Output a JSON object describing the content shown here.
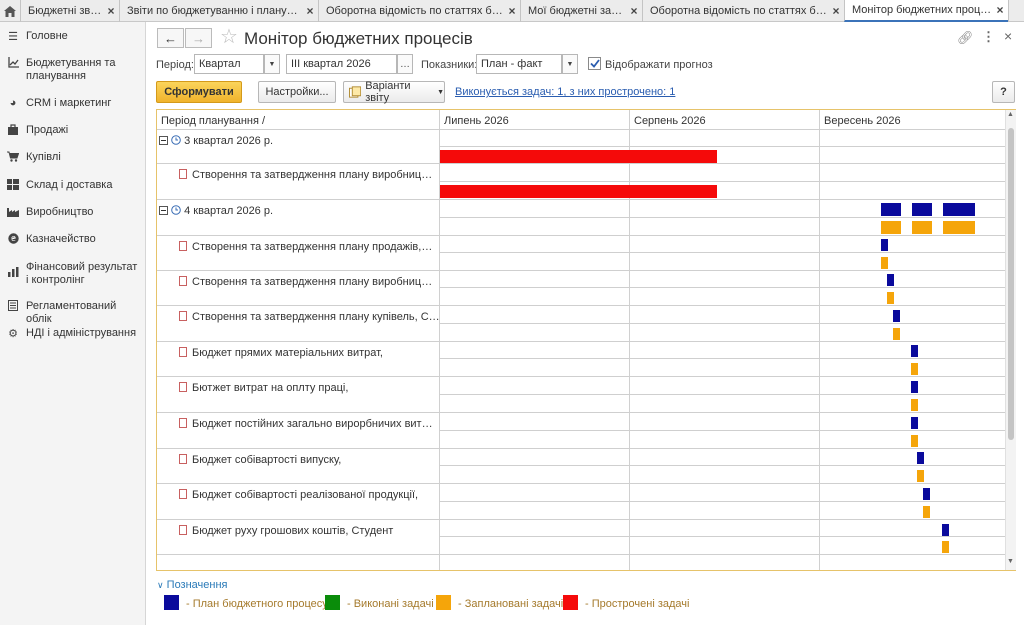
{
  "tabs": [
    {
      "label": "Бюджетні звіти"
    },
    {
      "label": "Звіти по бюджетуванню і плануван..."
    },
    {
      "label": "Оборотна відомість по статтях бюд..."
    },
    {
      "label": "Мої бюджетні задачі"
    },
    {
      "label": "Оборотна відомість по статтях бюд..."
    },
    {
      "label": "Монітор бюджетних процесів"
    }
  ],
  "sidebar": {
    "items": [
      {
        "label": "Головне",
        "icon": "menu-icon"
      },
      {
        "label": "Бюджетування та планування",
        "icon": "chart-line-icon"
      },
      {
        "label": "CRM і маркетинг",
        "icon": "pie-chart-icon"
      },
      {
        "label": "Продажі",
        "icon": "bag-icon"
      },
      {
        "label": "Купівлі",
        "icon": "cart-icon"
      },
      {
        "label": "Склад і доставка",
        "icon": "warehouse-icon"
      },
      {
        "label": "Виробництво",
        "icon": "factory-icon"
      },
      {
        "label": "Казначейство",
        "icon": "coin-icon"
      },
      {
        "label": "Фінансовий результат і контролінг",
        "icon": "bar-chart-icon"
      },
      {
        "label": "Регламентований облік",
        "icon": "book-icon"
      },
      {
        "label": "НДІ і адміністрування",
        "icon": "gear-icon"
      }
    ]
  },
  "header": {
    "title": "Монітор бюджетних процесів"
  },
  "filters": {
    "period_label": "Період:",
    "period_value": "Квартал",
    "period_range": "III квартал 2026",
    "indicators_label": "Показники:",
    "indicators_value": "План - факт",
    "show_forecast_label": "Відображати прогноз",
    "show_forecast": true
  },
  "toolbar": {
    "generate": "Сформувати",
    "settings": "Настройки...",
    "variants": "Варіанти звіту",
    "status_link": "Виконується задач: 1, з них прострочено: 1",
    "help": "?"
  },
  "grid": {
    "col_header": "Період планування /",
    "months": [
      "Липень 2026",
      "Серпень 2026",
      "Вересень 2026"
    ],
    "rows": [
      {
        "type": "group",
        "label": "3 квартал 2026 р."
      },
      {
        "type": "task",
        "label": "Створення та затвердження плану виробництва, П..."
      },
      {
        "type": "group",
        "label": "4 квартал 2026 р."
      },
      {
        "type": "task",
        "label": "Створення та затвердження плану продажів, Студ..."
      },
      {
        "type": "task",
        "label": "Створення та затвердження плану виробництва, С..."
      },
      {
        "type": "task",
        "label": "Створення та затвердження плану купівель, Студент"
      },
      {
        "type": "task",
        "label": "Бюджет прямих матеріальних витрат,"
      },
      {
        "type": "task",
        "label": "Бютжет витрат на оплту праці,"
      },
      {
        "type": "task",
        "label": "Бюджет постійних загально вирорбничих витрат, ..."
      },
      {
        "type": "task",
        "label": "Бюджет собівартості випуску,"
      },
      {
        "type": "task",
        "label": "Бюджет собівартості реалізованої продукції,"
      },
      {
        "type": "task",
        "label": "Бюджет руху грошових коштів, Студент"
      }
    ]
  },
  "legend": {
    "title": "Позначення",
    "items": [
      {
        "label": "- План бюджетного процесу",
        "color": "#0a0a9c"
      },
      {
        "label": "- Виконані задачі",
        "color": "#0a8c0a"
      },
      {
        "label": "- Заплановані задачі",
        "color": "#f5a50a"
      },
      {
        "label": "- Прострочені задачі",
        "color": "#f50a0a"
      }
    ]
  }
}
